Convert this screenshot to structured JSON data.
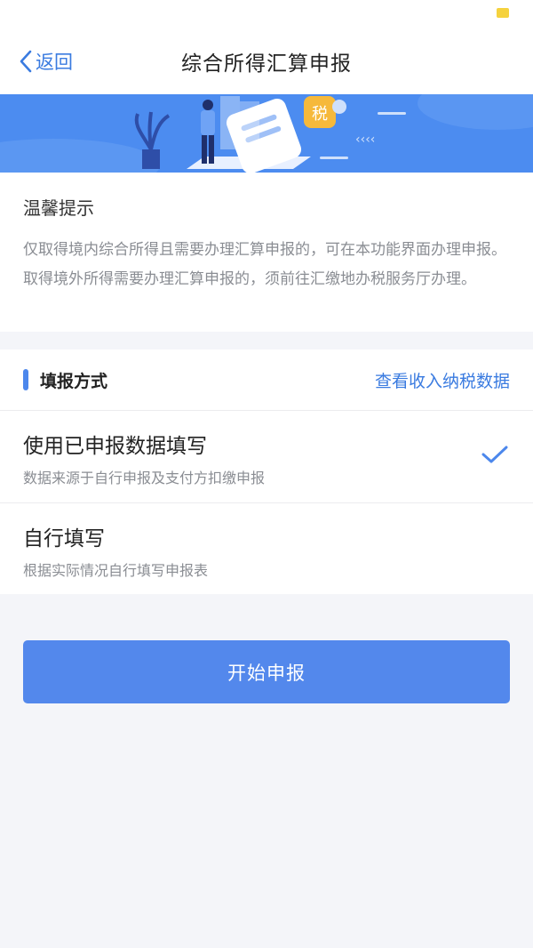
{
  "nav": {
    "back_label": "返回",
    "title": "综合所得汇算申报"
  },
  "banner": {
    "tax_char": "税"
  },
  "notice": {
    "title": "温馨提示",
    "body": "仅取得境内综合所得且需要办理汇算申报的，可在本功能界面办理申报。取得境外所得需要办理汇算申报的，须前往汇缴地办税服务厅办理。"
  },
  "method": {
    "title": "填报方式",
    "view_link": "查看收入纳税数据",
    "options": [
      {
        "title": "使用已申报数据填写",
        "desc": "数据来源于自行申报及支付方扣缴申报",
        "selected": true
      },
      {
        "title": "自行填写",
        "desc": "根据实际情况自行填写申报表",
        "selected": false
      }
    ]
  },
  "submit_label": "开始申报",
  "colors": {
    "accent": "#5388ec",
    "link": "#3a7be0",
    "battery": "#f5d23e"
  }
}
